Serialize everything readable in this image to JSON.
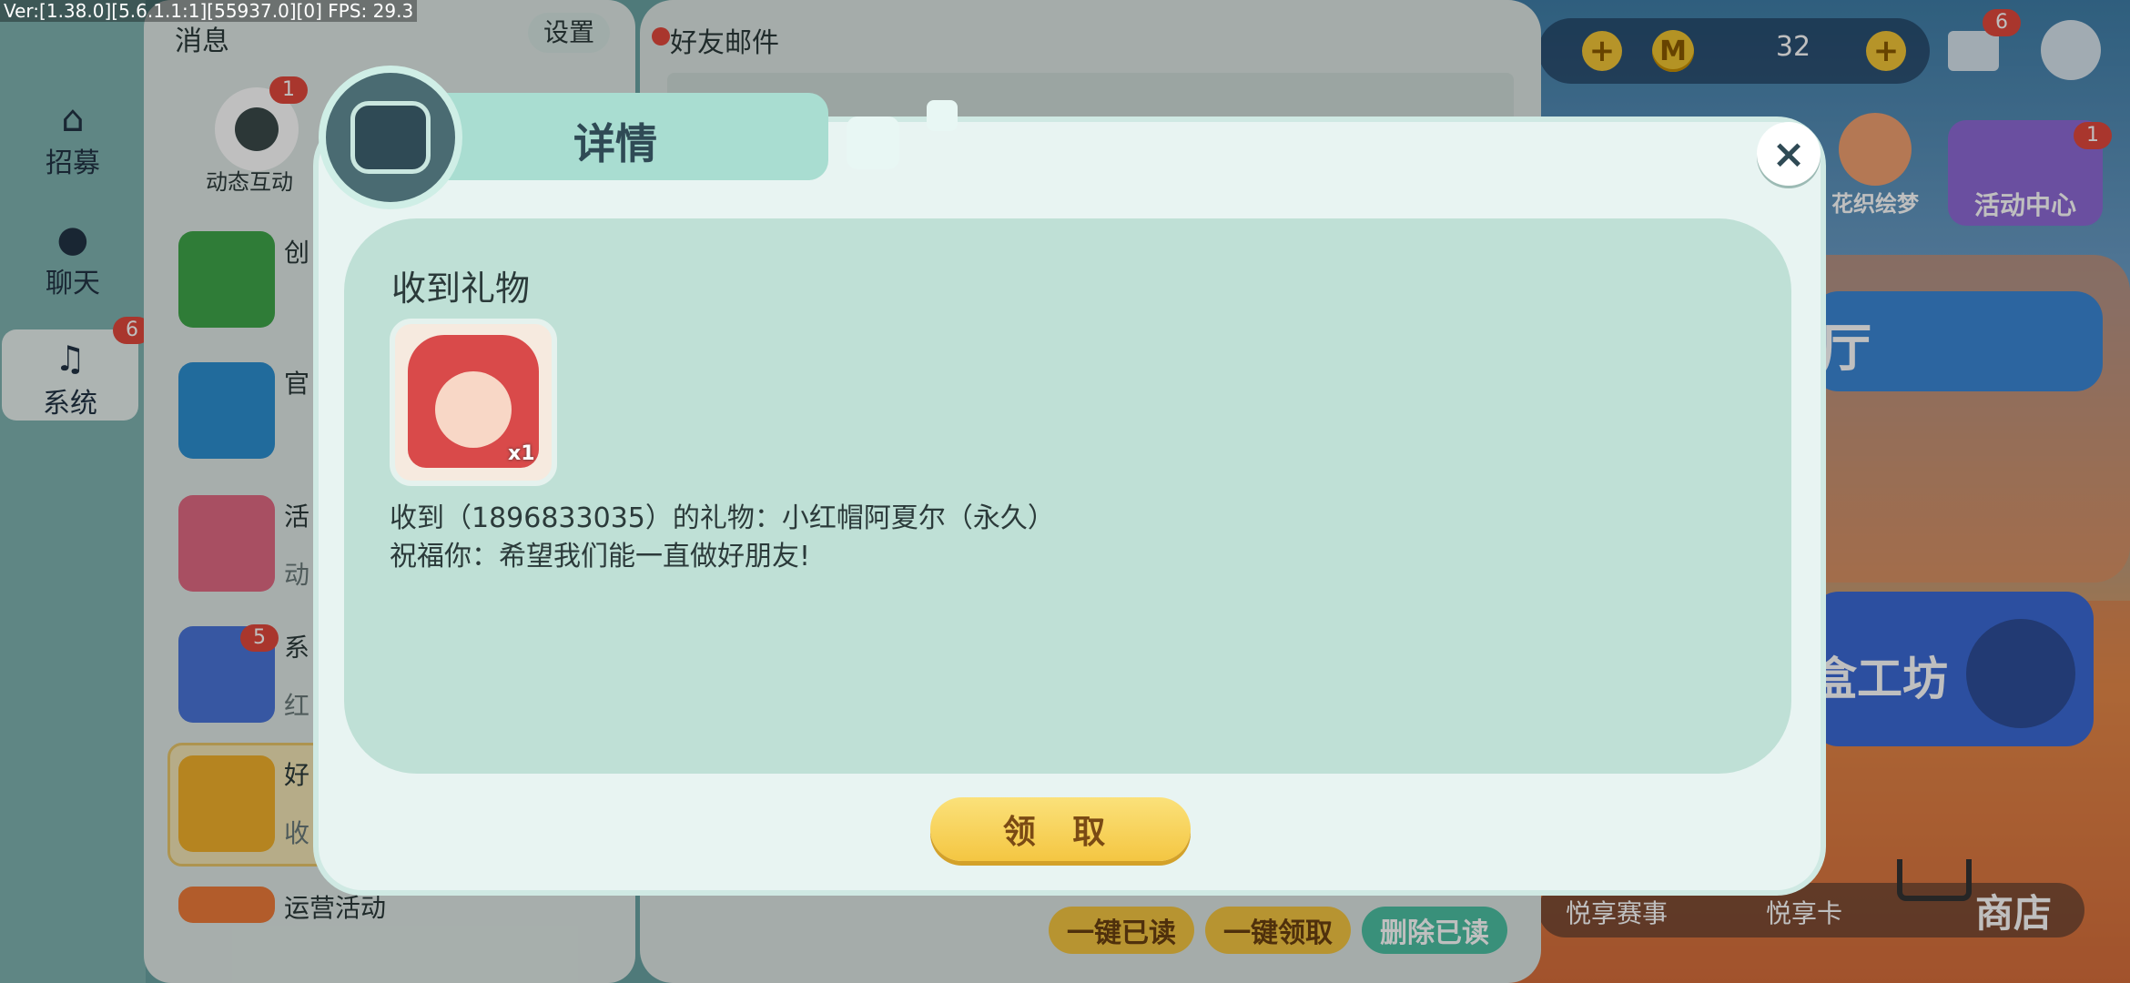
{
  "debug": "Ver:[1.38.0][5.6.1.1:1][55937.0][0] FPS: 29.3",
  "nav": {
    "recruit": "招募",
    "chat": "聊天",
    "system": "系统",
    "system_badge": "6"
  },
  "list_panel": {
    "title": "消息",
    "settings": "设置",
    "interaction_label": "动态互动",
    "interaction_badge": "1",
    "items": [
      {
        "title": "创",
        "sub": ""
      },
      {
        "title": "官",
        "sub": ""
      },
      {
        "title": "活",
        "sub": "动"
      },
      {
        "title": "系",
        "sub": "红",
        "badge": "5"
      },
      {
        "title": "好",
        "sub": "收"
      },
      {
        "title": "运营活动",
        "sub": ""
      }
    ]
  },
  "mail_panel": {
    "title": "好友邮件",
    "read_all": "一键已读",
    "claim_all": "一键领取",
    "delete_read": "删除已读"
  },
  "hud": {
    "coins": "32",
    "mail_badge": "6",
    "event_badge": "1",
    "flower_label": "花织绘梦",
    "event_center": "活动中心",
    "hall_fragment": "厅",
    "workshop_fragment": "盒工坊",
    "yuexiang_event": "悦享赛事",
    "yuexiang_card": "悦享卡",
    "shop": "商店"
  },
  "modal": {
    "title": "详情",
    "gift_heading": "收到礼物",
    "gift_count": "x1",
    "message_line1": "收到（1896833035）的礼物：小红帽阿夏尔（永久）",
    "message_line2": "祝福你：希望我们能一直做好朋友!",
    "claim_button": "领 取",
    "close": "×"
  },
  "colors": {
    "accent_yellow": "#f4c642",
    "modal_bg": "#e8f4f2",
    "modal_inner": "#bfe0d6",
    "badge_red": "#e2483d"
  }
}
